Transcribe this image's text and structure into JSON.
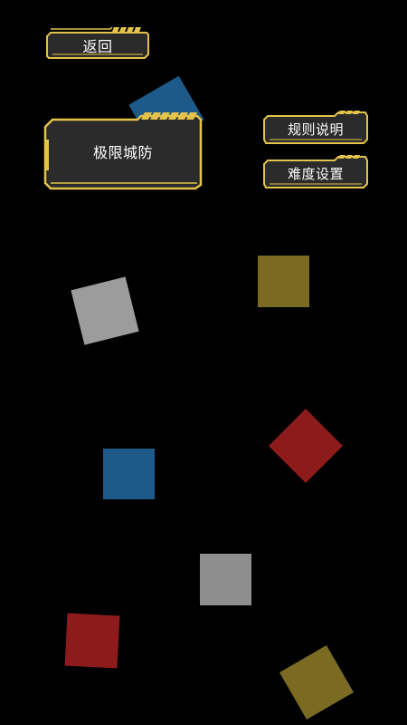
{
  "buttons": {
    "back": "返回",
    "mode": "极限城防",
    "rules": "规则说明",
    "difficulty": "难度设置"
  },
  "colors": {
    "frame_gold": "#e3c34a",
    "panel": "#2b2b2b",
    "tile_gray": "#9c9c9c",
    "tile_olive": "#7a6a22",
    "tile_red": "#8e1b1b",
    "tile_blue": "#1d5a89"
  },
  "tiles": [
    {
      "id": "tile-gray-1",
      "color": "tile_gray"
    },
    {
      "id": "tile-olive-1",
      "color": "tile_olive"
    },
    {
      "id": "tile-red-1",
      "color": "tile_red"
    },
    {
      "id": "tile-blue-1",
      "color": "tile_blue"
    },
    {
      "id": "tile-gray-2",
      "color": "tile_gray"
    },
    {
      "id": "tile-red-2",
      "color": "tile_red"
    },
    {
      "id": "tile-olive-2",
      "color": "tile_olive"
    },
    {
      "id": "tile-blue-back",
      "color": "tile_blue"
    }
  ]
}
